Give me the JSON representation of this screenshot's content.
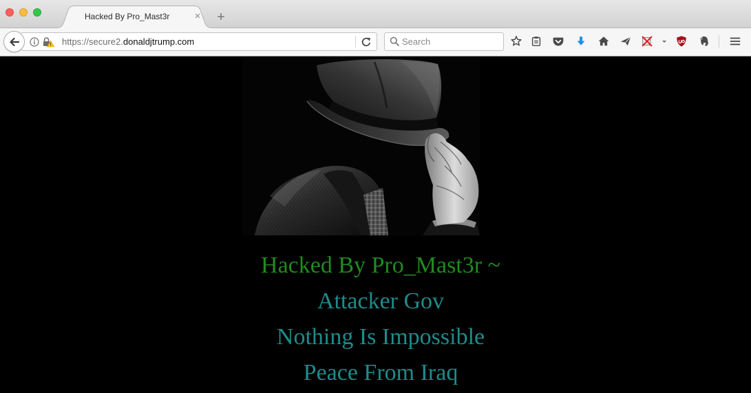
{
  "window": {
    "controls": [
      {
        "icon": "close-icon",
        "color": "#fc605c"
      },
      {
        "icon": "minimize-icon",
        "color": "#fdbc40"
      },
      {
        "icon": "zoom-icon",
        "color": "#34c84a"
      }
    ]
  },
  "tabs": [
    {
      "title": "Hacked By Pro_Mast3r",
      "close": "×",
      "active": true
    }
  ],
  "new_tab": "+",
  "toolbar": {
    "back_icon": "back-arrow-icon",
    "identity_icons": [
      "info-icon",
      "insecure-lock-warning-icon"
    ],
    "url": {
      "prefix": "https://secure2.",
      "domain": "donaldjtrump.com"
    },
    "reload_icon": "reload-icon",
    "search": {
      "icon": "search-icon",
      "placeholder": "Search"
    },
    "buttons": [
      "star-icon",
      "clipboard-icon",
      "pocket-icon",
      "download-arrow-icon",
      "home-icon",
      "paper-plane-icon",
      "blocked-x-icon",
      "chevron-down-icon",
      "ublock-shield-icon",
      "evernote-elephant-icon",
      "hamburger-icon"
    ],
    "accent_colors": {
      "download": "#1e90e6",
      "blocker": "#e0262b",
      "ublock": "#a3121b"
    }
  },
  "page": {
    "background": "#000000",
    "headline": {
      "text": "Hacked By Pro_Mast3r ~",
      "color": "#1f8c1f"
    },
    "lines": [
      "Attacker Gov",
      "Nothing Is Impossible",
      "Peace From Iraq"
    ],
    "lines_color": "#1f8b8c"
  }
}
